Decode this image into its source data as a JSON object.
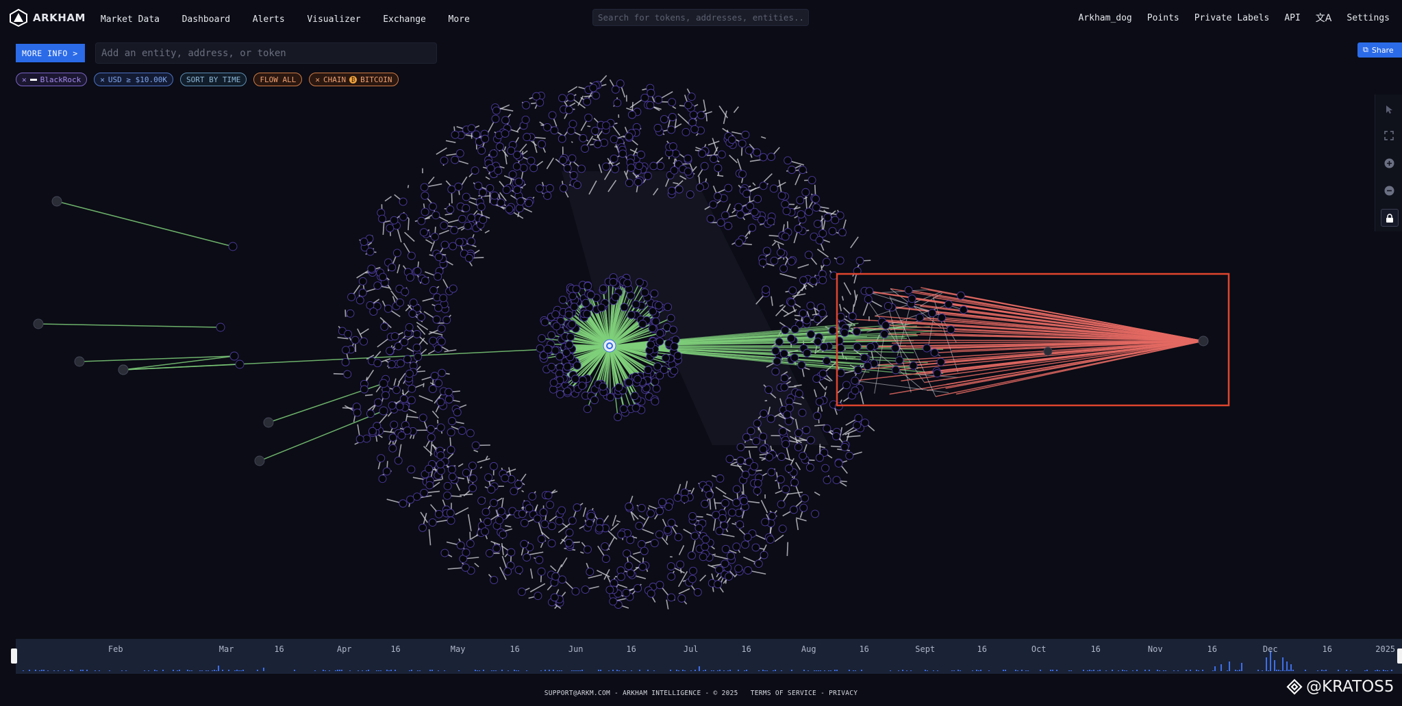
{
  "brand": {
    "name": "ARKHAM"
  },
  "nav": {
    "items": [
      "Market Data",
      "Dashboard",
      "Alerts",
      "Visualizer",
      "Exchange",
      "More"
    ],
    "right_items": [
      "Arkham_dog",
      "Points",
      "Private Labels",
      "API",
      "Settings"
    ]
  },
  "search": {
    "placeholder": "Search for tokens, addresses, entities..."
  },
  "toolbar": {
    "more_info_label": "MORE INFO >",
    "entity_placeholder": "Add an entity, address, or token",
    "share_label": "Share"
  },
  "filters": {
    "entity": "BlackRock",
    "usd": "USD ≥ $10.00K",
    "sort": "SORT BY TIME",
    "flow": "FLOW ALL",
    "chain_prefix": "CHAIN",
    "chain": "BITCOIN"
  },
  "colors": {
    "background": "#0b0c15",
    "accent": "#2b6be8",
    "inflow": "#7fcf7a",
    "outflow": "#e46a63",
    "highlight_box": "#e0452e",
    "node_ring": "#4b3a9c"
  },
  "timeline": {
    "months": [
      "Feb",
      "Mar",
      "16",
      "Apr",
      "16",
      "May",
      "16",
      "Jun",
      "16",
      "Jul",
      "16",
      "Aug",
      "16",
      "Sept",
      "16",
      "Oct",
      "16",
      "Nov",
      "16",
      "Dec",
      "16",
      "2025"
    ],
    "month_pos": [
      0.072,
      0.152,
      0.19,
      0.237,
      0.274,
      0.319,
      0.36,
      0.404,
      0.444,
      0.487,
      0.527,
      0.572,
      0.612,
      0.656,
      0.697,
      0.738,
      0.779,
      0.822,
      0.863,
      0.905,
      0.946,
      0.988
    ]
  },
  "footer": {
    "support": "SUPPORT@ARKM.COM",
    "company": "ARKHAM INTELLIGENCE",
    "copyright": "© 2025",
    "terms": "TERMS OF SERVICE",
    "privacy": "PRIVACY"
  },
  "watermark": {
    "handle": "@KRATOS5"
  }
}
